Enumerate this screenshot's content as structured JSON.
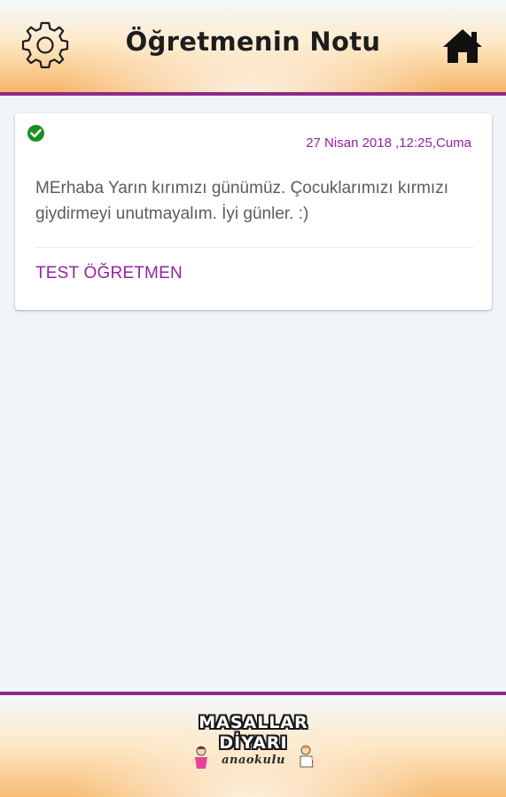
{
  "header": {
    "title": "Öğretmenin Notu",
    "settings_icon": "gear-icon",
    "home_icon": "home-icon"
  },
  "note": {
    "status_icon": "check-circle-icon",
    "date": "27 Nisan 2018 ,12:25,Cuma",
    "message": "MErhaba Yarın kırımızı günümüz. Çocuklarımızı kırmızı giydirmeyi unutmayalım. İyi günler. :)",
    "author": "TEST ÖĞRETMEN"
  },
  "footer": {
    "logo_line1": "MASALLAR",
    "logo_line2": "DİYARI",
    "logo_line3": "anaokulu"
  },
  "colors": {
    "accent_purple": "#9323a0",
    "border_purple": "#8e2a86",
    "status_green": "#1a8f22",
    "background": "#f1f5f9"
  }
}
